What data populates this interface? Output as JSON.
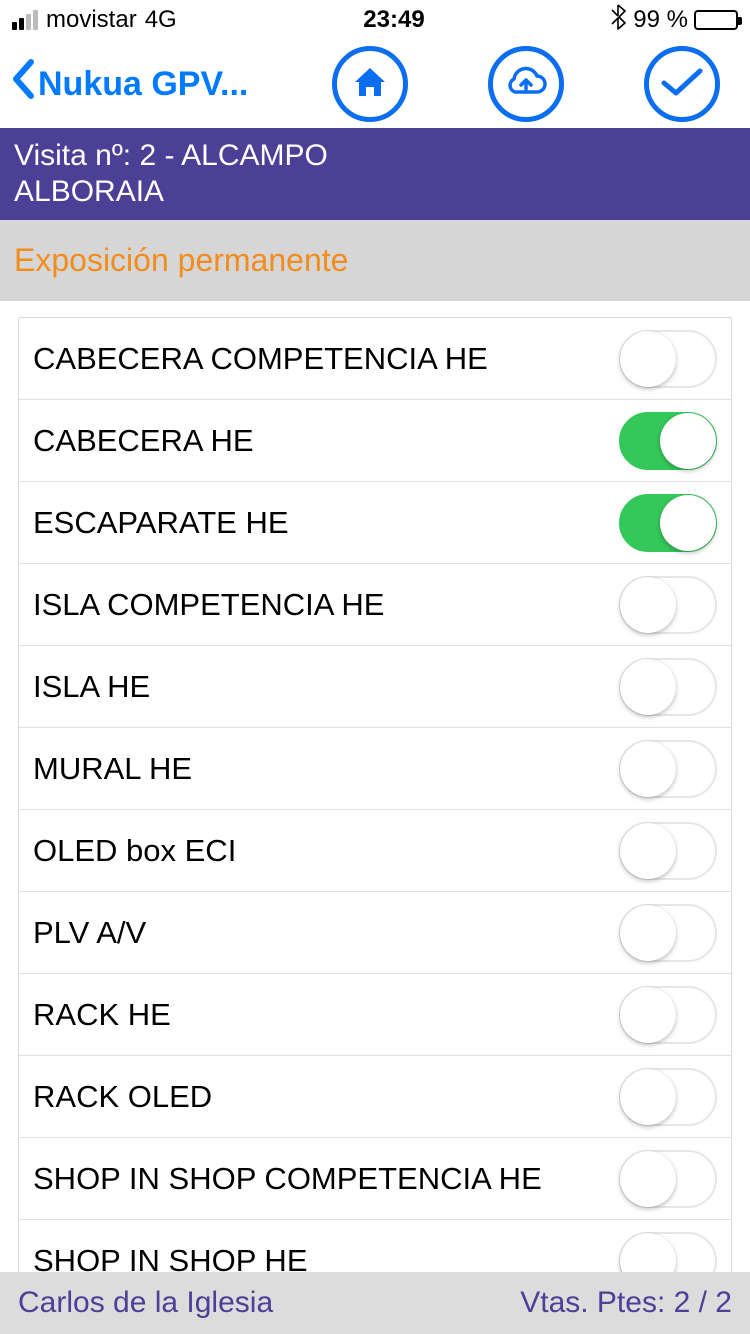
{
  "status": {
    "carrier": "movistar",
    "network": "4G",
    "time": "23:49",
    "battery_pct": "99 %"
  },
  "nav": {
    "back_title": "Nukua GPV..."
  },
  "visit": {
    "line1": "Visita nº: 2 - ALCAMPO",
    "line2": "ALBORAIA"
  },
  "section": {
    "title": "Exposición permanente"
  },
  "items": [
    {
      "label": "CABECERA COMPETENCIA HE",
      "on": false
    },
    {
      "label": "CABECERA HE",
      "on": true
    },
    {
      "label": "ESCAPARATE HE",
      "on": true
    },
    {
      "label": "ISLA COMPETENCIA HE",
      "on": false
    },
    {
      "label": "ISLA HE",
      "on": false
    },
    {
      "label": "MURAL HE",
      "on": false
    },
    {
      "label": "OLED box ECI",
      "on": false
    },
    {
      "label": "PLV A/V",
      "on": false
    },
    {
      "label": "RACK HE",
      "on": false
    },
    {
      "label": "RACK OLED",
      "on": false
    },
    {
      "label": "SHOP IN SHOP COMPETENCIA HE",
      "on": false
    },
    {
      "label": "SHOP IN SHOP HE",
      "on": false
    }
  ],
  "footer": {
    "user": "Carlos de la Iglesia",
    "pending": "Vtas. Ptes: 2 / 2"
  }
}
